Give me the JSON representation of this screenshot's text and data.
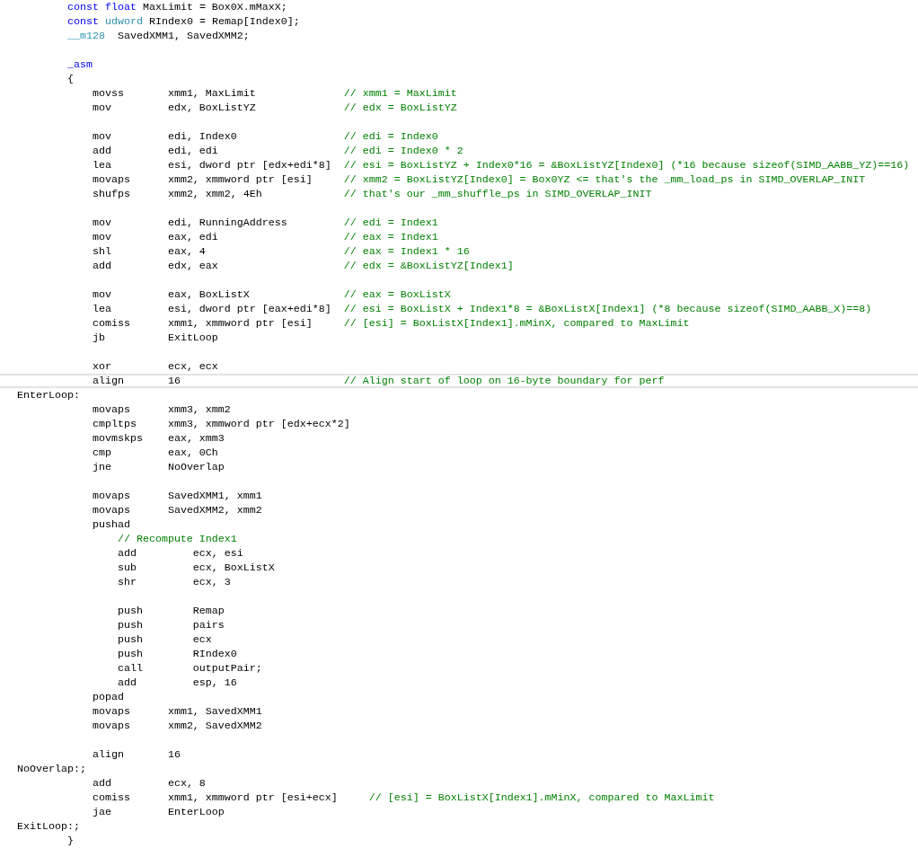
{
  "editor": {
    "lines": [
      {
        "current": false,
        "tokens": [
          {
            "kind": "keyword",
            "text": "        const float"
          },
          {
            "kind": "plain",
            "text": " MaxLimit = Box0X.mMaxX;"
          }
        ]
      },
      {
        "current": false,
        "tokens": [
          {
            "kind": "keyword",
            "text": "        const"
          },
          {
            "kind": "type",
            "text": " udword"
          },
          {
            "kind": "plain",
            "text": " RIndex0 = Remap[Index0];"
          }
        ]
      },
      {
        "current": false,
        "tokens": [
          {
            "kind": "type",
            "text": "        __m128"
          },
          {
            "kind": "plain",
            "text": "  SavedXMM1, SavedXMM2;"
          }
        ]
      },
      {
        "current": false
      },
      {
        "current": false,
        "tokens": [
          {
            "kind": "keyword",
            "text": "        _asm"
          }
        ]
      },
      {
        "current": false,
        "tokens": [
          {
            "kind": "plain",
            "text": "        {"
          }
        ]
      },
      {
        "current": false,
        "tokens": [
          {
            "kind": "plain",
            "text": "            movss       xmm1, MaxLimit"
          },
          {
            "kind": "comment",
            "text": "              // xmm1 = MaxLimit"
          }
        ]
      },
      {
        "current": false,
        "tokens": [
          {
            "kind": "plain",
            "text": "            mov         edx, BoxListYZ"
          },
          {
            "kind": "comment",
            "text": "              // edx = BoxListYZ"
          }
        ]
      },
      {
        "current": false
      },
      {
        "current": false,
        "tokens": [
          {
            "kind": "plain",
            "text": "            mov         edi, Index0"
          },
          {
            "kind": "comment",
            "text": "                 // edi = Index0"
          }
        ]
      },
      {
        "current": false,
        "tokens": [
          {
            "kind": "plain",
            "text": "            add         edi, edi"
          },
          {
            "kind": "comment",
            "text": "                    // edi = Index0 * 2"
          }
        ]
      },
      {
        "current": false,
        "tokens": [
          {
            "kind": "plain",
            "text": "            lea         esi, dword ptr [edx+edi*8]"
          },
          {
            "kind": "comment",
            "text": "  // esi = BoxListYZ + Index0*16 = &BoxListYZ[Index0] (*16 because sizeof(SIMD_AABB_YZ)==16)"
          }
        ]
      },
      {
        "current": false,
        "tokens": [
          {
            "kind": "plain",
            "text": "            movaps      xmm2, xmmword ptr [esi]"
          },
          {
            "kind": "comment",
            "text": "     // xmm2 = BoxListYZ[Index0] = Box0YZ <= that's the _mm_load_ps in SIMD_OVERLAP_INIT"
          }
        ]
      },
      {
        "current": false,
        "tokens": [
          {
            "kind": "plain",
            "text": "            shufps      xmm2, xmm2, 4Eh"
          },
          {
            "kind": "comment",
            "text": "             // that's our _mm_shuffle_ps in SIMD_OVERLAP_INIT"
          }
        ]
      },
      {
        "current": false
      },
      {
        "current": false,
        "tokens": [
          {
            "kind": "plain",
            "text": "            mov         edi, RunningAddress"
          },
          {
            "kind": "comment",
            "text": "         // edi = Index1"
          }
        ]
      },
      {
        "current": false,
        "tokens": [
          {
            "kind": "plain",
            "text": "            mov         eax, edi"
          },
          {
            "kind": "comment",
            "text": "                    // eax = Index1"
          }
        ]
      },
      {
        "current": false,
        "tokens": [
          {
            "kind": "plain",
            "text": "            shl         eax, 4"
          },
          {
            "kind": "comment",
            "text": "                      // eax = Index1 * 16"
          }
        ]
      },
      {
        "current": false,
        "tokens": [
          {
            "kind": "plain",
            "text": "            add         edx, eax"
          },
          {
            "kind": "comment",
            "text": "                    // edx = &BoxListYZ[Index1]"
          }
        ]
      },
      {
        "current": false
      },
      {
        "current": false,
        "tokens": [
          {
            "kind": "plain",
            "text": "            mov         eax, BoxListX"
          },
          {
            "kind": "comment",
            "text": "               // eax = BoxListX"
          }
        ]
      },
      {
        "current": false,
        "tokens": [
          {
            "kind": "plain",
            "text": "            lea         esi, dword ptr [eax+edi*8]"
          },
          {
            "kind": "comment",
            "text": "  // esi = BoxListX + Index1*8 = &BoxListX[Index1] (*8 because sizeof(SIMD_AABB_X)==8)"
          }
        ]
      },
      {
        "current": false,
        "tokens": [
          {
            "kind": "plain",
            "text": "            comiss      xmm1, xmmword ptr [esi]"
          },
          {
            "kind": "comment",
            "text": "     // [esi] = BoxListX[Index1].mMinX, compared to MaxLimit"
          }
        ]
      },
      {
        "current": false,
        "tokens": [
          {
            "kind": "plain",
            "text": "            jb          ExitLoop"
          }
        ]
      },
      {
        "current": false
      },
      {
        "current": false,
        "tokens": [
          {
            "kind": "plain",
            "text": "            xor         ecx, ecx"
          }
        ]
      },
      {
        "current": true,
        "tokens": [
          {
            "kind": "plain",
            "text": "            align       16"
          },
          {
            "kind": "comment",
            "text": "                          // Align start of loop on 16-byte boundary for perf"
          }
        ]
      },
      {
        "current": false,
        "tokens": [
          {
            "kind": "plain",
            "text": "EnterLoop:"
          }
        ]
      },
      {
        "current": false,
        "tokens": [
          {
            "kind": "plain",
            "text": "            movaps      xmm3, xmm2"
          }
        ]
      },
      {
        "current": false,
        "tokens": [
          {
            "kind": "plain",
            "text": "            cmpltps     xmm3, xmmword ptr [edx+ecx*2]"
          }
        ]
      },
      {
        "current": false,
        "tokens": [
          {
            "kind": "plain",
            "text": "            movmskps    eax, xmm3"
          }
        ]
      },
      {
        "current": false,
        "tokens": [
          {
            "kind": "plain",
            "text": "            cmp         eax, 0Ch"
          }
        ]
      },
      {
        "current": false,
        "tokens": [
          {
            "kind": "plain",
            "text": "            jne         NoOverlap"
          }
        ]
      },
      {
        "current": false
      },
      {
        "current": false,
        "tokens": [
          {
            "kind": "plain",
            "text": "            movaps      SavedXMM1, xmm1"
          }
        ]
      },
      {
        "current": false,
        "tokens": [
          {
            "kind": "plain",
            "text": "            movaps      SavedXMM2, xmm2"
          }
        ]
      },
      {
        "current": false,
        "tokens": [
          {
            "kind": "plain",
            "text": "            pushad"
          }
        ]
      },
      {
        "current": false,
        "tokens": [
          {
            "kind": "comment",
            "text": "                // Recompute Index1"
          }
        ]
      },
      {
        "current": false,
        "tokens": [
          {
            "kind": "plain",
            "text": "                add         ecx, esi"
          }
        ]
      },
      {
        "current": false,
        "tokens": [
          {
            "kind": "plain",
            "text": "                sub         ecx, BoxListX"
          }
        ]
      },
      {
        "current": false,
        "tokens": [
          {
            "kind": "plain",
            "text": "                shr         ecx, 3"
          }
        ]
      },
      {
        "current": false
      },
      {
        "current": false,
        "tokens": [
          {
            "kind": "plain",
            "text": "                push        Remap"
          }
        ]
      },
      {
        "current": false,
        "tokens": [
          {
            "kind": "plain",
            "text": "                push        pairs"
          }
        ]
      },
      {
        "current": false,
        "tokens": [
          {
            "kind": "plain",
            "text": "                push        ecx"
          }
        ]
      },
      {
        "current": false,
        "tokens": [
          {
            "kind": "plain",
            "text": "                push        RIndex0"
          }
        ]
      },
      {
        "current": false,
        "tokens": [
          {
            "kind": "plain",
            "text": "                call        outputPair;"
          }
        ]
      },
      {
        "current": false,
        "tokens": [
          {
            "kind": "plain",
            "text": "                add         esp, 16"
          }
        ]
      },
      {
        "current": false,
        "tokens": [
          {
            "kind": "plain",
            "text": "            popad"
          }
        ]
      },
      {
        "current": false,
        "tokens": [
          {
            "kind": "plain",
            "text": "            movaps      xmm1, SavedXMM1"
          }
        ]
      },
      {
        "current": false,
        "tokens": [
          {
            "kind": "plain",
            "text": "            movaps      xmm2, SavedXMM2"
          }
        ]
      },
      {
        "current": false
      },
      {
        "current": false,
        "tokens": [
          {
            "kind": "plain",
            "text": "            align       16"
          }
        ]
      },
      {
        "current": false,
        "tokens": [
          {
            "kind": "plain",
            "text": "NoOverlap:;"
          }
        ]
      },
      {
        "current": false,
        "tokens": [
          {
            "kind": "plain",
            "text": "            add         ecx, 8"
          }
        ]
      },
      {
        "current": false,
        "tokens": [
          {
            "kind": "plain",
            "text": "            comiss      xmm1, xmmword ptr [esi+ecx]"
          },
          {
            "kind": "comment",
            "text": "     // [esi] = BoxListX[Index1].mMinX, compared to MaxLimit"
          }
        ]
      },
      {
        "current": false,
        "tokens": [
          {
            "kind": "plain",
            "text": "            jae         EnterLoop"
          }
        ]
      },
      {
        "current": false,
        "tokens": [
          {
            "kind": "plain",
            "text": "ExitLoop:;"
          }
        ]
      },
      {
        "current": false,
        "tokens": [
          {
            "kind": "plain",
            "text": "        }"
          }
        ]
      }
    ]
  }
}
